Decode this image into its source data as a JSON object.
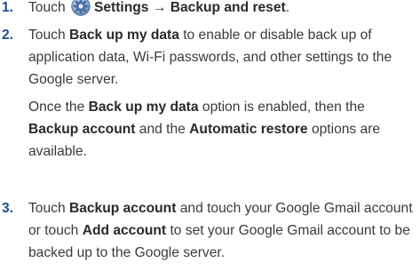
{
  "steps": [
    {
      "number": "1.",
      "t1": "Touch ",
      "b1": "Settings → Backup and reset",
      "t2": "."
    },
    {
      "number": "2.",
      "t1": "Touch ",
      "b1": "Back up my data",
      "t2": " to enable or disable back up of application data, Wi-Fi passwords, and other settings to the Google server.",
      "p2_t1": "Once the ",
      "p2_b1": "Back up my data",
      "p2_t2": " option is enabled, then the ",
      "p2_b2": "Backup account",
      "p2_t3": " and the ",
      "p2_b3": "Automatic restore",
      "p2_t4": " options are available."
    },
    {
      "number": "3.",
      "t1": "Touch ",
      "b1": "Backup account",
      "t2": " and touch your Google Gmail account or touch ",
      "b2": "Add account",
      "t3": " to set your Google Gmail account to be backed up to the Google server."
    }
  ],
  "icons": {
    "settings": "gear-icon"
  },
  "colors": {
    "text": "#3a3a3a",
    "number": "#1f4e8c",
    "icon": "#4a6fa5"
  }
}
